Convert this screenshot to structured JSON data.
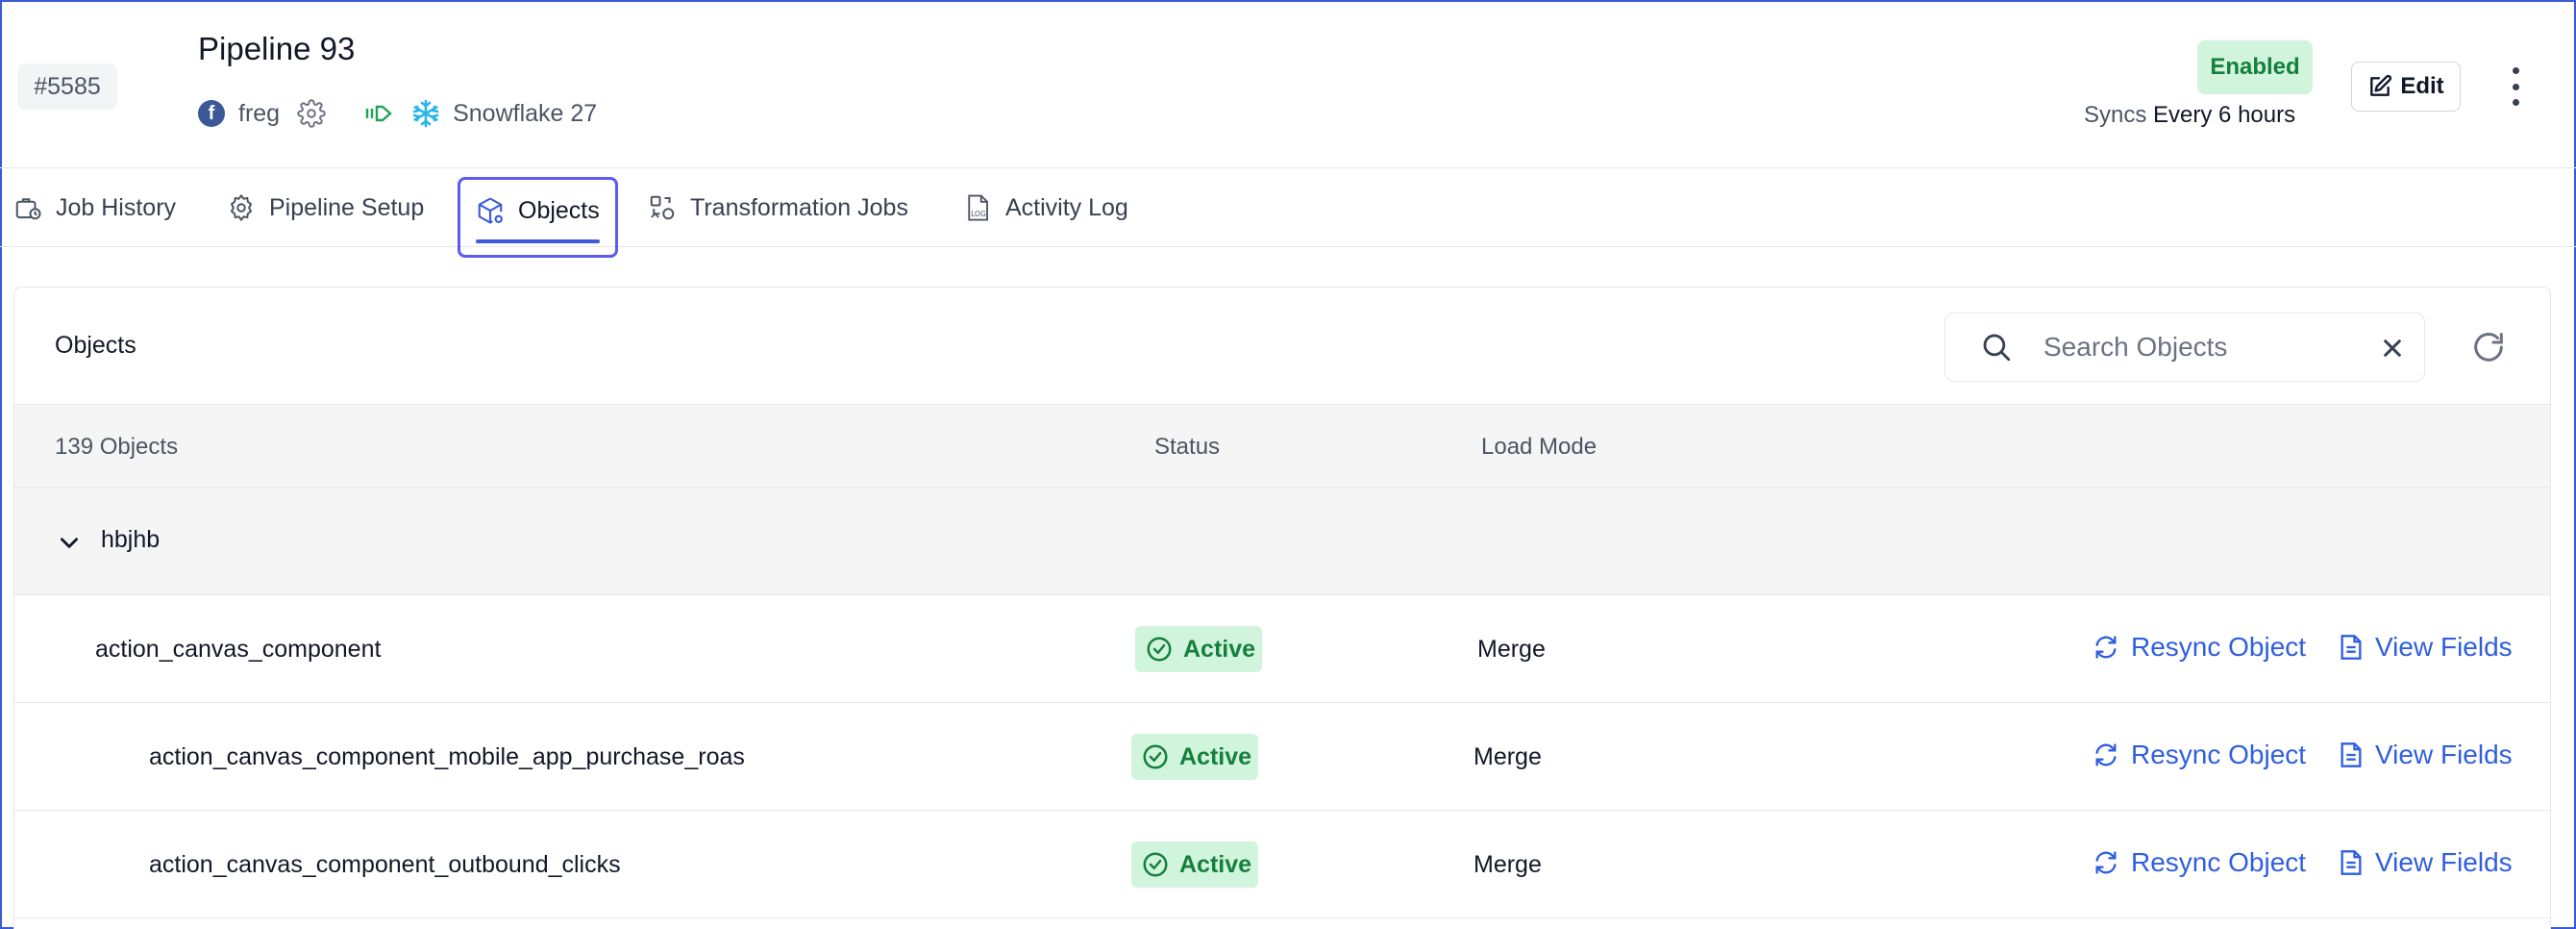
{
  "header": {
    "id_badge": "#5585",
    "title": "Pipeline 93",
    "source_name": "freg",
    "destination_name": "Snowflake 27",
    "status_badge": "Enabled",
    "syncs_label": "Syncs",
    "syncs_value": "Every 6 hours",
    "edit_label": "Edit"
  },
  "tabs": [
    {
      "label": "Job History",
      "icon": "job-history-icon"
    },
    {
      "label": "Pipeline Setup",
      "icon": "gear-icon"
    },
    {
      "label": "Objects",
      "icon": "cube-icon",
      "active": true
    },
    {
      "label": "Transformation Jobs",
      "icon": "transformation-icon"
    },
    {
      "label": "Activity Log",
      "icon": "log-file-icon"
    }
  ],
  "objects": {
    "title": "Objects",
    "search_placeholder": "Search Objects",
    "columns": {
      "count": "139 Objects",
      "status": "Status",
      "load_mode": "Load Mode"
    },
    "group": "hbjhb",
    "rows": [
      {
        "name": "action_canvas_component",
        "status": "Active",
        "load_mode": "Merge",
        "resync": "Resync Object",
        "view": "View Fields"
      },
      {
        "name": "action_canvas_component_mobile_app_purchase_roas",
        "status": "Active",
        "load_mode": "Merge",
        "resync": "Resync Object",
        "view": "View Fields"
      },
      {
        "name": "action_canvas_component_outbound_clicks",
        "status": "Active",
        "load_mode": "Merge",
        "resync": "Resync Object",
        "view": "View Fields"
      }
    ]
  },
  "colors": {
    "accent": "#2f5fe0",
    "status_green_bg": "#d1f4dc",
    "status_green_text": "#15803d",
    "tab_focus": "#5b5bf0"
  }
}
